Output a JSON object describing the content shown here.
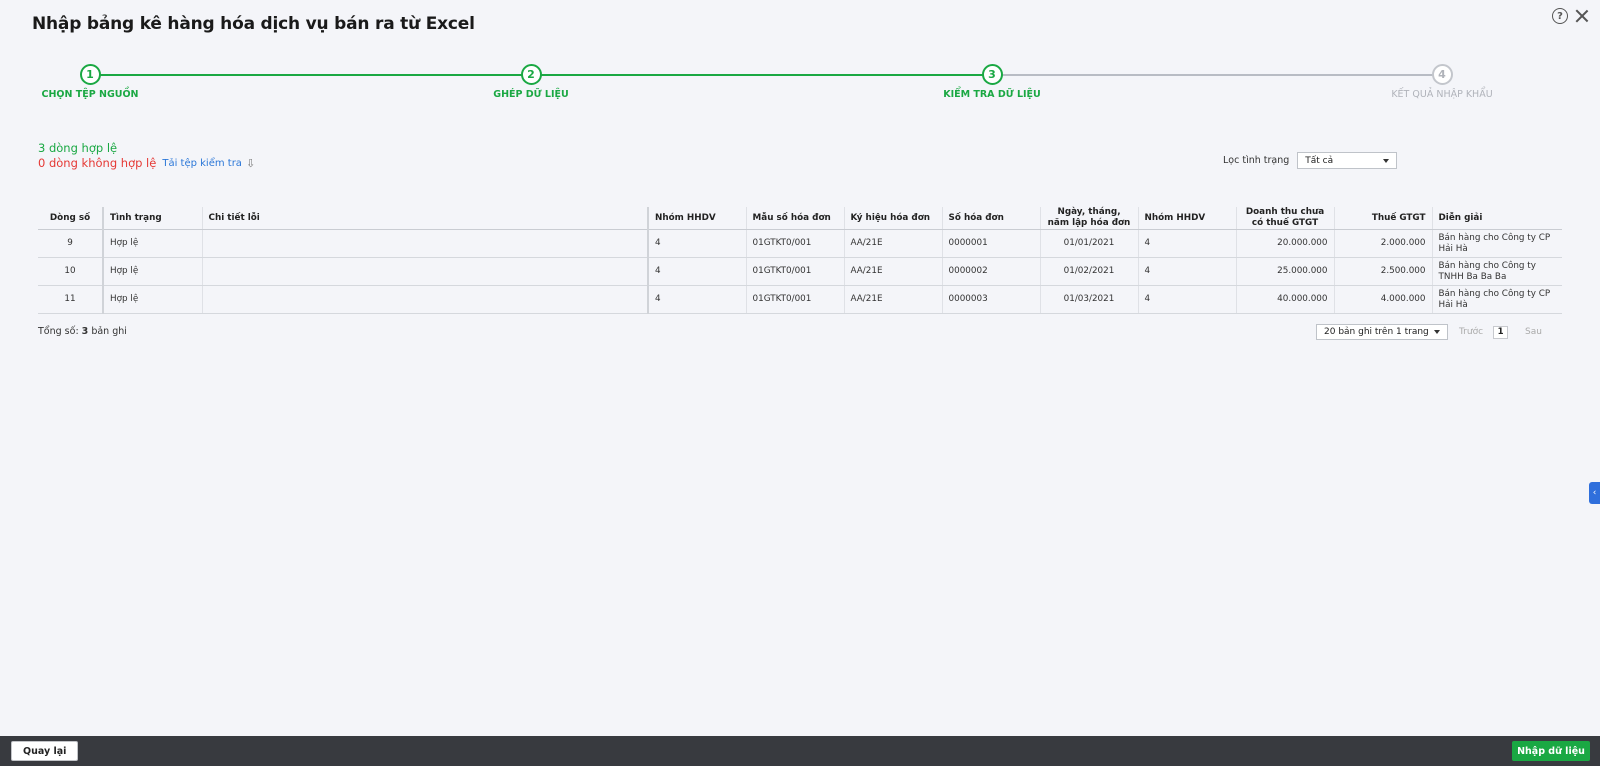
{
  "dialog": {
    "title": "Nhập bảng kê hàng hóa dịch vụ bán ra từ Excel"
  },
  "steps": [
    {
      "number": "1",
      "label": "CHỌN TỆP NGUỒN"
    },
    {
      "number": "2",
      "label": "GHÉP DỮ LIỆU"
    },
    {
      "number": "3",
      "label": "KIỂM TRA DỮ LIỆU"
    },
    {
      "number": "4",
      "label": "KẾT QUẢ NHẬP KHẨU"
    }
  ],
  "summary": {
    "valid": "3 dòng hợp lệ",
    "invalid": "0 dòng không hợp lệ",
    "download_link": "Tải tệp kiểm tra"
  },
  "filter": {
    "label": "Lọc tình trạng",
    "value": "Tất cả"
  },
  "table": {
    "columns": [
      "Dòng số",
      "Tình trạng",
      "Chi tiết lỗi",
      "Nhóm HHDV",
      "Mẫu số hóa đơn",
      "Ký hiệu hóa đơn",
      "Số hóa đơn",
      "Ngày, tháng, năm lập hóa đơn",
      "Nhóm HHDV",
      "Doanh thu chưa có thuế GTGT",
      "Thuế GTGT",
      "Diễn giải"
    ],
    "rows": [
      {
        "line": "9",
        "status": "Hợp lệ",
        "error": "",
        "group": "4",
        "form": "01GTKT0/001",
        "symbol": "AA/21E",
        "number": "0000001",
        "date": "01/01/2021",
        "group2": "4",
        "revenue": "20.000.000",
        "vat": "2.000.000",
        "desc": "Bán hàng cho Công ty CP Hải Hà"
      },
      {
        "line": "10",
        "status": "Hợp lệ",
        "error": "",
        "group": "4",
        "form": "01GTKT0/001",
        "symbol": "AA/21E",
        "number": "0000002",
        "date": "01/02/2021",
        "group2": "4",
        "revenue": "25.000.000",
        "vat": "2.500.000",
        "desc": "Bán hàng cho Công ty TNHH Ba Ba Ba"
      },
      {
        "line": "11",
        "status": "Hợp lệ",
        "error": "",
        "group": "4",
        "form": "01GTKT0/001",
        "symbol": "AA/21E",
        "number": "0000003",
        "date": "01/03/2021",
        "group2": "4",
        "revenue": "40.000.000",
        "vat": "4.000.000",
        "desc": "Bán hàng cho Công ty CP Hải Hà"
      }
    ]
  },
  "footer": {
    "total_prefix": "Tổng số: ",
    "total_count": "3",
    "total_suffix": " bản ghi",
    "page_size": "20 bản ghi trên 1 trang",
    "prev": "Trước",
    "page": "1",
    "next": "Sau"
  },
  "buttons": {
    "back": "Quay lại",
    "import": "Nhập dữ liệu"
  },
  "icons": {
    "help": "help-icon",
    "close": "close-icon",
    "download": "download-icon",
    "collapse": "chevron-left-icon"
  },
  "colors": {
    "accent": "#1aa843",
    "error": "#e53935",
    "link": "#2b77d8",
    "bottom_bar": "#383a3f"
  }
}
